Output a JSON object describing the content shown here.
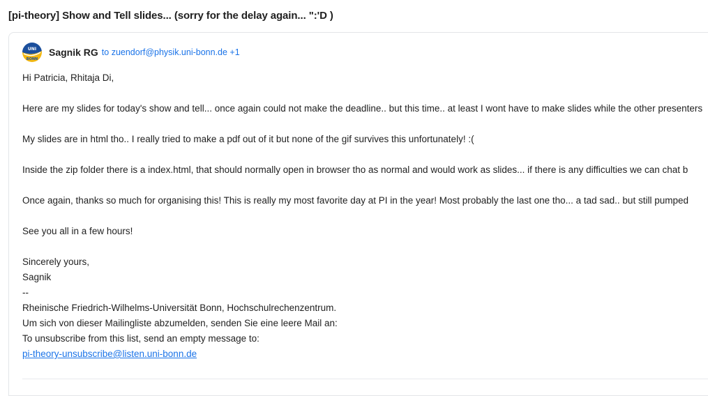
{
  "email": {
    "subject": "[pi-theory] Show and Tell slides... (sorry for the delay again... \":'D )",
    "sender": "Sagnik RG",
    "recipients": "to zuendorf@physik.uni-bonn.de +1",
    "avatar_icon": "university-bonn-logo-icon",
    "body": {
      "greeting": "Hi Patricia, Rhitaja Di,",
      "p1": "Here are my slides for today's show and tell... once again could not make the deadline.. but this time.. at least I wont have to make slides while the other presenters",
      "p2": "My slides are in html tho.. I really tried to make a pdf out of it but none of the gif survives this unfortunately! :(",
      "p3": "Inside the zip folder there is a index.html, that should normally open in browser tho as normal and would work as slides... if there is any difficulties we can chat b",
      "p4": "Once again, thanks so much for organising this! This is really my most favorite day at PI in the year! Most probably the last one tho... a tad sad.. but still pumped",
      "p5": "See you all in a few hours!",
      "signoff": "Sincerely yours,",
      "signature_name": "Sagnik",
      "separator": "--",
      "footer_line1": "Rheinische Friedrich-Wilhelms-Universität Bonn, Hochschulrechenzentrum.",
      "footer_line2": "Um sich von dieser Mailingliste abzumelden, senden Sie eine leere Mail an:",
      "footer_line3": "To unsubscribe from this list, send an empty message to:",
      "unsubscribe_link": "pi-theory-unsubscribe@listen.uni-bonn.de"
    }
  },
  "colors": {
    "link": "#1a73e8",
    "text": "#1f1f1f",
    "avatar_blue": "#1b4f9c",
    "avatar_yellow": "#f2b711"
  }
}
